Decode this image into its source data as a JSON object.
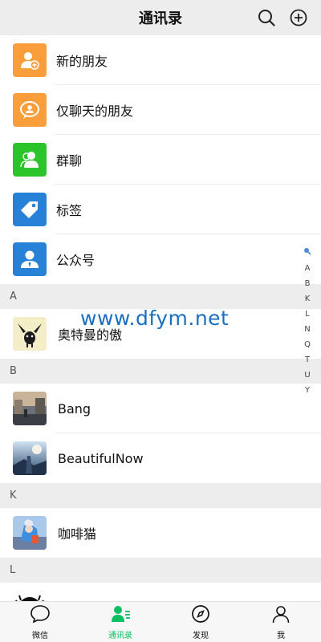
{
  "header": {
    "title": "通讯录"
  },
  "features": [
    {
      "label": "新的朋友",
      "color": "#fa9d3b",
      "icon": "new-friend-icon"
    },
    {
      "label": "仅聊天的朋友",
      "color": "#fa9d3b",
      "icon": "chat-only-icon"
    },
    {
      "label": "群聊",
      "color": "#2bc42b",
      "icon": "group-chat-icon"
    },
    {
      "label": "标签",
      "color": "#2782d7",
      "icon": "tag-icon"
    },
    {
      "label": "公众号",
      "color": "#2782d7",
      "icon": "official-account-icon"
    }
  ],
  "sections": [
    {
      "letter": "A",
      "contacts": [
        {
          "name": "奥特曼的傲"
        }
      ]
    },
    {
      "letter": "B",
      "contacts": [
        {
          "name": "Bang"
        },
        {
          "name": "BeautifulNow"
        }
      ]
    },
    {
      "letter": "K",
      "contacts": [
        {
          "name": "咖啡猫"
        }
      ]
    },
    {
      "letter": "L",
      "contacts": []
    }
  ],
  "watermark": "www.dfym.net",
  "index": [
    "A",
    "B",
    "K",
    "L",
    "N",
    "Q",
    "T",
    "U",
    "Y"
  ],
  "tabs": [
    {
      "label": "微信",
      "icon": "chat-bubble-icon",
      "active": false
    },
    {
      "label": "通讯录",
      "icon": "contacts-icon",
      "active": true
    },
    {
      "label": "发现",
      "icon": "compass-icon",
      "active": false
    },
    {
      "label": "我",
      "icon": "person-icon",
      "active": false
    }
  ],
  "colors": {
    "accent": "#07c160",
    "header_bg": "#ededed",
    "watermark": "#1a6fc2"
  }
}
